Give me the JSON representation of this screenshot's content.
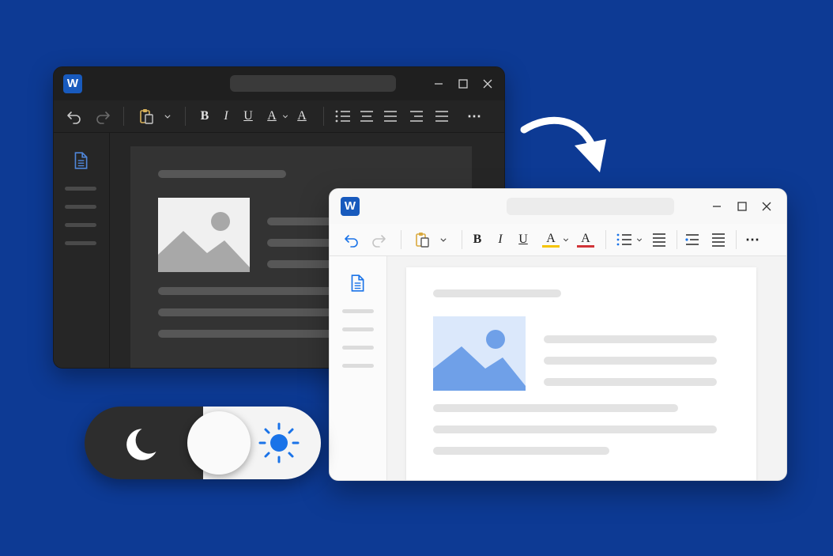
{
  "app_icon_letter": "W",
  "colors": {
    "background": "#0d3a94",
    "word_blue": "#185abd",
    "highlight_yellow": "#f5c400",
    "font_color_red": "#d13438",
    "sun_blue": "#1a73e8"
  },
  "dark_window": {
    "toolbar": {
      "bold": "B",
      "italic": "I",
      "underline": "U",
      "highlight": "A",
      "font_color": "A",
      "more": "⋯"
    }
  },
  "light_window": {
    "toolbar": {
      "bold": "B",
      "italic": "I",
      "underline": "U",
      "highlight": "A",
      "font_color": "A",
      "more": "⋯"
    }
  },
  "theme_toggle": {
    "state": "light",
    "left_icon": "moon-icon",
    "right_icon": "sun-icon"
  }
}
